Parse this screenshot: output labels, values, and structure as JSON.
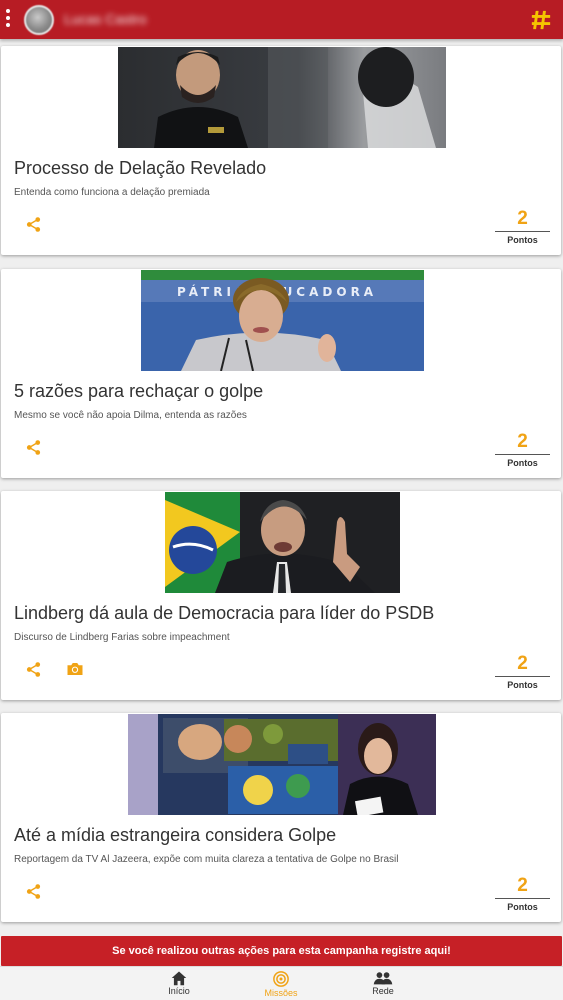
{
  "header": {
    "username": "Lucas Castro",
    "hash_icon": "hash-icon"
  },
  "cards": [
    {
      "title": "Processo de Delação Revelado",
      "description": "Entenda como funciona a delação premiada",
      "points": "2",
      "points_label": "Pontos",
      "image_desc": "man-at-desk-photo"
    },
    {
      "title": "5 razões para rechaçar o golpe",
      "description": "Mesmo se você não apoia Dilma, entenda as razões",
      "points": "2",
      "points_label": "Pontos",
      "banner_text": "PÁTRIA EDUCADORA"
    },
    {
      "title": "Lindberg dá aula de Democracia para líder do PSDB",
      "description": "Discurso de Lindberg Farias sobre impeachment",
      "points": "2",
      "points_label": "Pontos"
    },
    {
      "title": "Até a mídia estrangeira considera Golpe",
      "description": "Reportagem da TV Al Jazeera, expõe com muita clareza a tentativa de Golpe no Brasil",
      "points": "2",
      "points_label": "Pontos"
    }
  ],
  "cta": {
    "label": "Se você realizou outras ações para esta campanha registre aqui!"
  },
  "bottom_nav": [
    {
      "label": "Início",
      "icon": "home-icon",
      "active": false
    },
    {
      "label": "Missões",
      "icon": "target-icon",
      "active": true
    },
    {
      "label": "Rede",
      "icon": "people-icon",
      "active": false
    }
  ],
  "colors": {
    "primary": "#b71c24",
    "accent": "#f0a315"
  }
}
